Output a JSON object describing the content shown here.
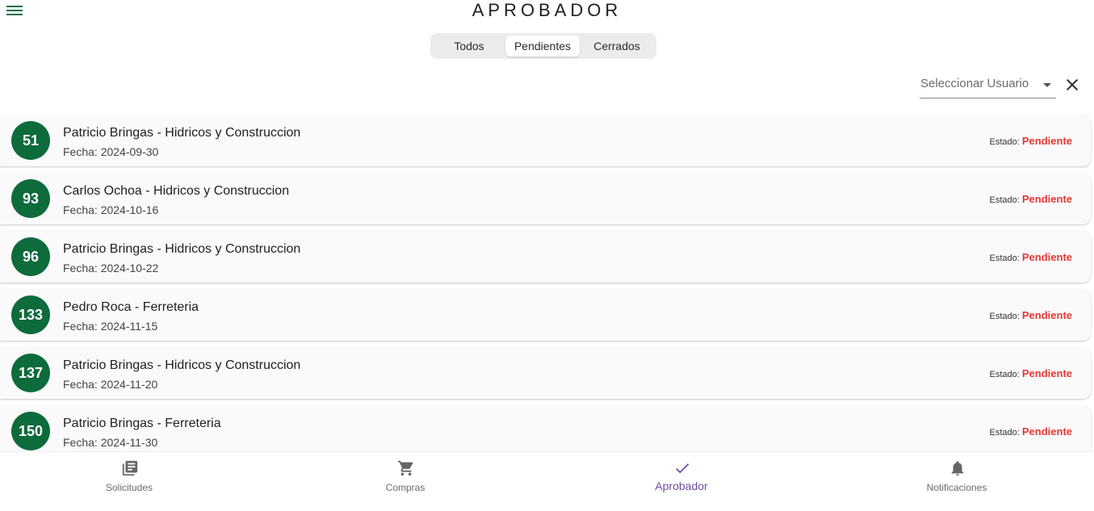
{
  "header": {
    "title": "APROBADOR",
    "menu_icon": "menu-icon"
  },
  "tabs": [
    {
      "label": "Todos",
      "active": false
    },
    {
      "label": "Pendientes",
      "active": true
    },
    {
      "label": "Cerrados",
      "active": false
    }
  ],
  "filter": {
    "placeholder": "Seleccionar Usuario",
    "dropdown_icon": "arrow-drop-down-icon",
    "clear_icon": "close-icon"
  },
  "requests": [
    {
      "number": "51",
      "title": "Patricio Bringas - Hidricos y Construccion",
      "date": "Fecha: 2024-09-30",
      "status_label": "Estado:",
      "status": "Pendiente"
    },
    {
      "number": "93",
      "title": "Carlos Ochoa - Hidricos y Construccion",
      "date": "Fecha: 2024-10-16",
      "status_label": "Estado:",
      "status": "Pendiente"
    },
    {
      "number": "96",
      "title": "Patricio Bringas - Hidricos y Construccion",
      "date": "Fecha: 2024-10-22",
      "status_label": "Estado:",
      "status": "Pendiente"
    },
    {
      "number": "133",
      "title": "Pedro Roca - Ferreteria",
      "date": "Fecha: 2024-11-15",
      "status_label": "Estado:",
      "status": "Pendiente"
    },
    {
      "number": "137",
      "title": "Patricio Bringas - Hidricos y Construccion",
      "date": "Fecha: 2024-11-20",
      "status_label": "Estado:",
      "status": "Pendiente"
    },
    {
      "number": "150",
      "title": "Patricio Bringas - Ferreteria",
      "date": "Fecha: 2024-11-30",
      "status_label": "Estado:",
      "status": "Pendiente"
    }
  ],
  "bottom_nav": [
    {
      "label": "Solicitudes",
      "icon": "library-books-icon",
      "active": false
    },
    {
      "label": "Compras",
      "icon": "shopping-cart-icon",
      "active": false
    },
    {
      "label": "Aprobador",
      "icon": "check-icon",
      "active": true
    },
    {
      "label": "Notificaciones",
      "icon": "bell-icon",
      "active": false
    }
  ],
  "colors": {
    "accent_green": "#0d6b3c",
    "status_red": "#e53935",
    "nav_active": "#6a4fa0"
  }
}
